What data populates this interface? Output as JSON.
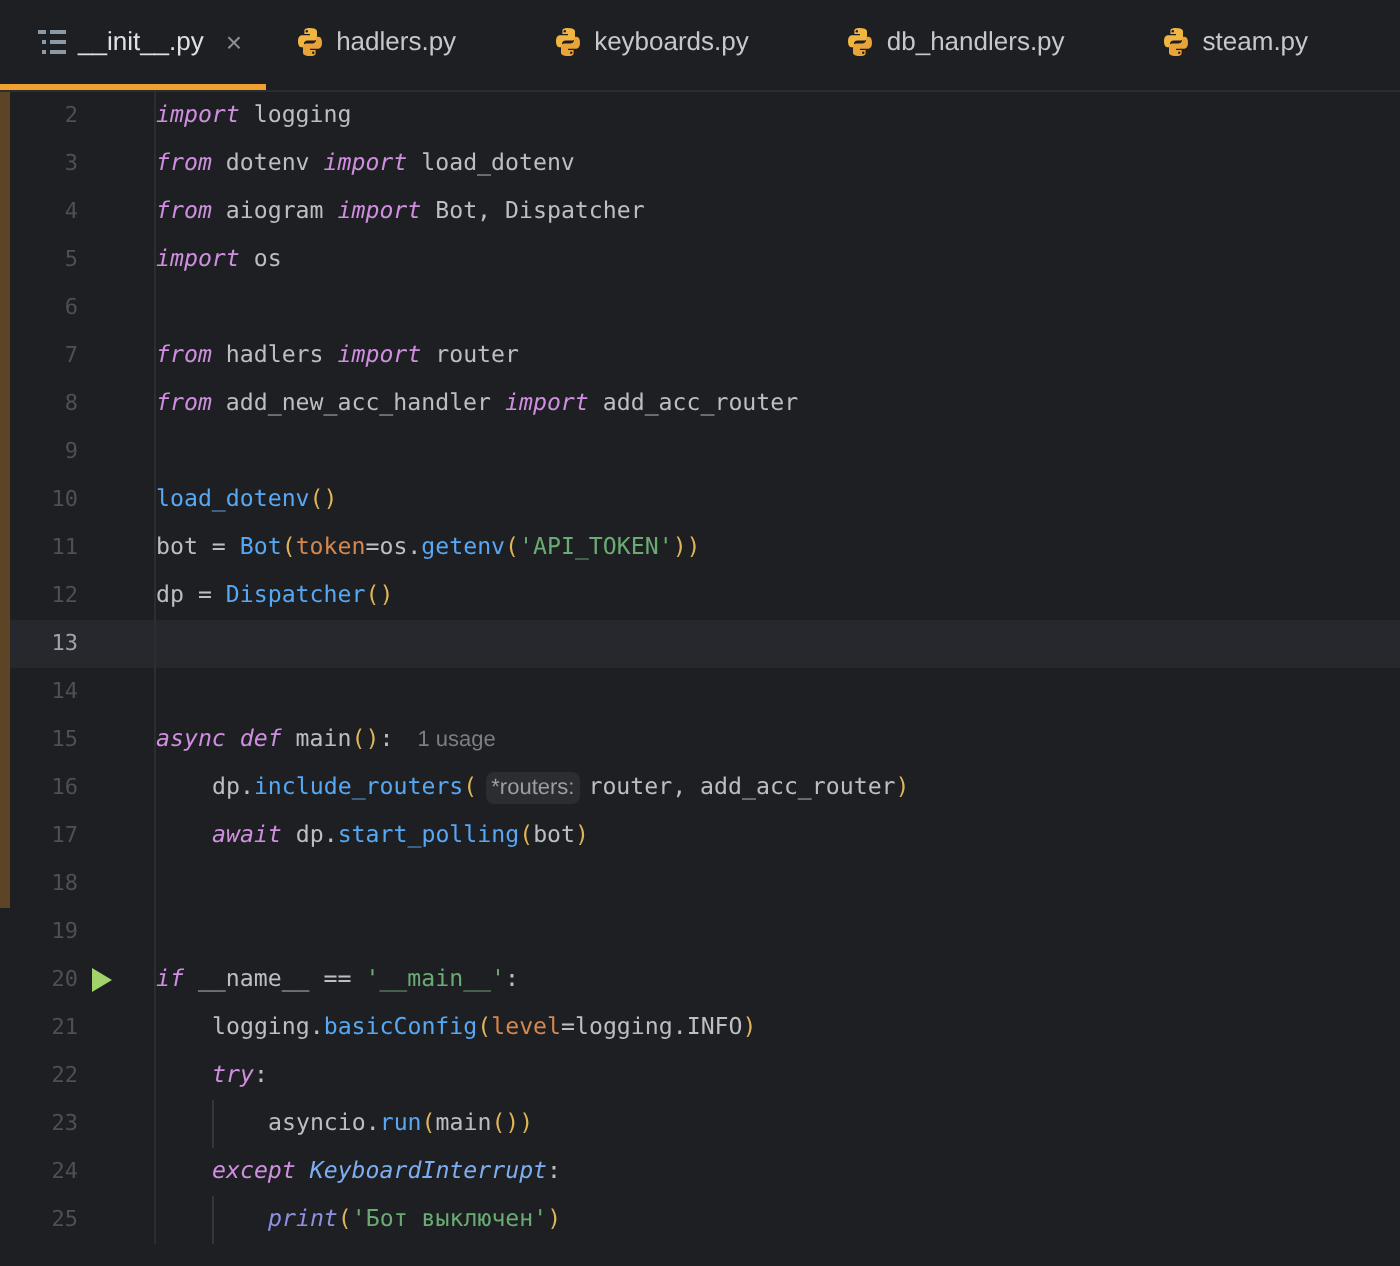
{
  "tabs": [
    {
      "label": "__init__.py",
      "kind": "structure",
      "selected": true,
      "close": "×"
    },
    {
      "label": "hadlers.py",
      "kind": "python",
      "selected": false
    },
    {
      "label": "keyboards.py",
      "kind": "python",
      "selected": false
    },
    {
      "label": "db_handlers.py",
      "kind": "python",
      "selected": false
    },
    {
      "label": "steam.py",
      "kind": "python",
      "selected": false
    }
  ],
  "lines": [
    {
      "number": "2",
      "modified": true,
      "tokens": [
        {
          "kind": "kw",
          "text": "import"
        },
        {
          "kind": "plain",
          "text": " logging"
        }
      ]
    },
    {
      "number": "3",
      "modified": true,
      "tokens": [
        {
          "kind": "kw",
          "text": "from"
        },
        {
          "kind": "plain",
          "text": " dotenv "
        },
        {
          "kind": "kw",
          "text": "import"
        },
        {
          "kind": "plain",
          "text": " load_dotenv"
        }
      ]
    },
    {
      "number": "4",
      "modified": true,
      "tokens": [
        {
          "kind": "kw",
          "text": "from"
        },
        {
          "kind": "plain",
          "text": " aiogram "
        },
        {
          "kind": "kw",
          "text": "import"
        },
        {
          "kind": "plain",
          "text": " Bot, Dispatcher"
        }
      ]
    },
    {
      "number": "5",
      "modified": true,
      "tokens": [
        {
          "kind": "kw",
          "text": "import"
        },
        {
          "kind": "plain",
          "text": " os"
        }
      ]
    },
    {
      "number": "6",
      "modified": true
    },
    {
      "number": "7",
      "modified": true,
      "tokens": [
        {
          "kind": "kw",
          "text": "from"
        },
        {
          "kind": "plain",
          "text": " hadlers "
        },
        {
          "kind": "kw",
          "text": "import"
        },
        {
          "kind": "plain",
          "text": " router"
        }
      ]
    },
    {
      "number": "8",
      "modified": true,
      "tokens": [
        {
          "kind": "kw",
          "text": "from"
        },
        {
          "kind": "plain",
          "text": " add_new_acc_handler "
        },
        {
          "kind": "kw",
          "text": "import"
        },
        {
          "kind": "plain",
          "text": " add_acc_router"
        }
      ]
    },
    {
      "number": "9",
      "modified": true
    },
    {
      "number": "10",
      "modified": true,
      "tokens": [
        {
          "kind": "fn",
          "text": "load_dotenv"
        },
        {
          "kind": "paren",
          "text": "()"
        }
      ]
    },
    {
      "number": "11",
      "modified": true,
      "tokens": [
        {
          "kind": "plain",
          "text": "bot = "
        },
        {
          "kind": "fn",
          "text": "Bot"
        },
        {
          "kind": "paren",
          "text": "("
        },
        {
          "kind": "param",
          "text": "token"
        },
        {
          "kind": "plain",
          "text": "=os."
        },
        {
          "kind": "fn",
          "text": "getenv"
        },
        {
          "kind": "paren",
          "text": "("
        },
        {
          "kind": "str",
          "text": "'API_TOKEN'"
        },
        {
          "kind": "paren",
          "text": "))"
        }
      ]
    },
    {
      "number": "12",
      "modified": true,
      "tokens": [
        {
          "kind": "plain",
          "text": "dp = "
        },
        {
          "kind": "fn",
          "text": "Dispatcher"
        },
        {
          "kind": "paren",
          "text": "()"
        }
      ]
    },
    {
      "number": "13",
      "modified": true,
      "current": true
    },
    {
      "number": "14",
      "modified": true
    },
    {
      "number": "15",
      "modified": true,
      "tokens": [
        {
          "kind": "kw",
          "text": "async def"
        },
        {
          "kind": "plain",
          "text": " main"
        },
        {
          "kind": "paren",
          "text": "()"
        },
        {
          "kind": "plain",
          "text": ":"
        },
        {
          "kind": "hint",
          "text": "1 usage"
        }
      ],
      "children": [
        {
          "number": "16",
          "modified": true,
          "tokens": [
            {
              "kind": "plain",
              "text": "dp."
            },
            {
              "kind": "fn",
              "text": "include_routers"
            },
            {
              "kind": "paren",
              "text": "("
            },
            {
              "kind": "inlay",
              "text": "*routers:"
            },
            {
              "kind": "plain",
              "text": "router, add_acc_router"
            },
            {
              "kind": "paren",
              "text": ")"
            }
          ]
        },
        {
          "number": "17",
          "modified": true,
          "tokens": [
            {
              "kind": "kw",
              "text": "await"
            },
            {
              "kind": "plain",
              "text": " dp."
            },
            {
              "kind": "fn",
              "text": "start_polling"
            },
            {
              "kind": "paren",
              "text": "("
            },
            {
              "kind": "plain",
              "text": "bot"
            },
            {
              "kind": "paren",
              "text": ")"
            }
          ]
        }
      ]
    },
    {
      "number": "18",
      "modified": true
    },
    {
      "number": "19",
      "modified": false
    },
    {
      "number": "20",
      "modified": false,
      "run": true,
      "tokens": [
        {
          "kind": "kw",
          "text": "if"
        },
        {
          "kind": "plain",
          "text": " __name__ == "
        },
        {
          "kind": "str",
          "text": "'__main__'"
        },
        {
          "kind": "plain",
          "text": ":"
        }
      ],
      "children": [
        {
          "number": "21",
          "modified": false,
          "tokens": [
            {
              "kind": "plain",
              "text": "logging."
            },
            {
              "kind": "fn",
              "text": "basicConfig"
            },
            {
              "kind": "paren",
              "text": "("
            },
            {
              "kind": "param",
              "text": "level"
            },
            {
              "kind": "plain",
              "text": "=logging.INFO"
            },
            {
              "kind": "paren",
              "text": ")"
            }
          ]
        },
        {
          "number": "22",
          "modified": false,
          "tokens": [
            {
              "kind": "kw",
              "text": "try"
            },
            {
              "kind": "plain",
              "text": ":"
            }
          ],
          "children": [
            {
              "number": "23",
              "modified": false,
              "tokens": [
                {
                  "kind": "plain",
                  "text": "asyncio."
                },
                {
                  "kind": "fn",
                  "text": "run"
                },
                {
                  "kind": "paren",
                  "text": "("
                },
                {
                  "kind": "plain",
                  "text": "main"
                },
                {
                  "kind": "paren",
                  "text": "())"
                }
              ]
            }
          ]
        },
        {
          "number": "24",
          "modified": false,
          "tokens": [
            {
              "kind": "kw",
              "text": "except"
            },
            {
              "kind": "cls",
              "text": " KeyboardInterrupt"
            },
            {
              "kind": "plain",
              "text": ":"
            }
          ],
          "children": [
            {
              "number": "25",
              "modified": false,
              "tokens": [
                {
                  "kind": "builtin",
                  "text": "print"
                },
                {
                  "kind": "paren",
                  "text": "("
                },
                {
                  "kind": "str",
                  "text": "'Бот выключен'"
                },
                {
                  "kind": "paren",
                  "text": ")"
                }
              ]
            }
          ]
        }
      ]
    }
  ]
}
